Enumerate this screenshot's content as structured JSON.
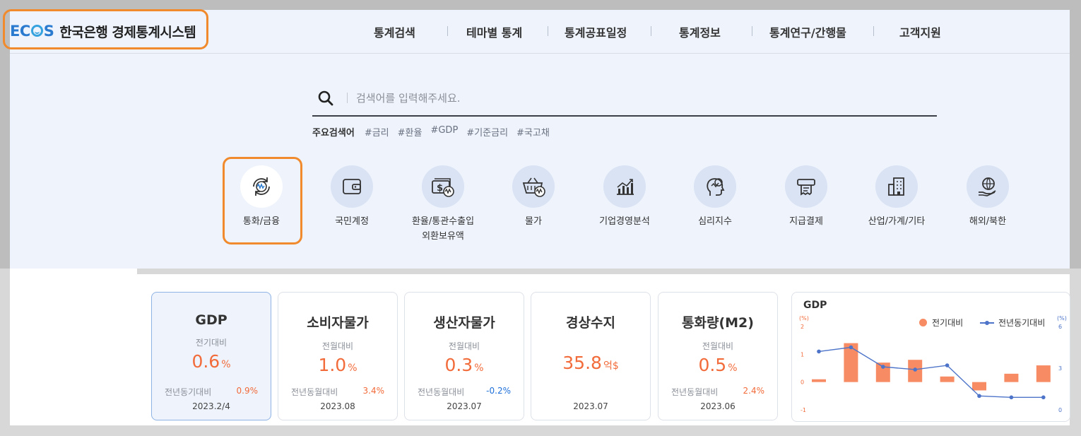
{
  "header": {
    "logo_brand": "ECOS",
    "logo_text": "한국은행 경제통계시스템",
    "nav": [
      "통계검색",
      "테마별 통계",
      "통계공표일정",
      "통계정보",
      "통계연구/간행물",
      "고객지원"
    ]
  },
  "search": {
    "placeholder": "검색어를 입력해주세요.",
    "keywords_label": "주요검색어",
    "keywords": [
      "#금리",
      "#환율",
      "#GDP",
      "#기준금리",
      "#국고채"
    ]
  },
  "categories": [
    {
      "label": "통화/금융",
      "icon": "currency-exchange-icon"
    },
    {
      "label": "국민계정",
      "icon": "wallet-icon"
    },
    {
      "label": "환율/통관수출입\n외환보유액",
      "icon": "money-exchange-icon"
    },
    {
      "label": "물가",
      "icon": "basket-icon"
    },
    {
      "label": "기업경영분석",
      "icon": "bar-chart-icon"
    },
    {
      "label": "심리지수",
      "icon": "head-icon"
    },
    {
      "label": "지급결제",
      "icon": "payment-icon"
    },
    {
      "label": "산업/가계/기타",
      "icon": "building-icon"
    },
    {
      "label": "해외/북한",
      "icon": "globe-hand-icon"
    }
  ],
  "cards": [
    {
      "title": "GDP",
      "sublabel": "전기대비",
      "value": "0.6",
      "unit": "%",
      "yoy_label": "전년동기대비",
      "yoy_value": "0.9%",
      "date": "2023.2/4"
    },
    {
      "title": "소비자물가",
      "sublabel": "전월대비",
      "value": "1.0",
      "unit": "%",
      "yoy_label": "전년동월대비",
      "yoy_value": "3.4%",
      "date": "2023.08"
    },
    {
      "title": "생산자물가",
      "sublabel": "전월대비",
      "value": "0.3",
      "unit": "%",
      "yoy_label": "전년동월대비",
      "yoy_value": "-0.2%",
      "date": "2023.07"
    },
    {
      "title": "경상수지",
      "sublabel": "",
      "value": "35.8",
      "unit": "억$",
      "yoy_label": "",
      "yoy_value": "",
      "date": "2023.07"
    },
    {
      "title": "통화량(M2)",
      "sublabel": "전월대비",
      "value": "0.5",
      "unit": "%",
      "yoy_label": "전년동월대비",
      "yoy_value": "2.4%",
      "date": "2023.06"
    }
  ],
  "colors": {
    "accent": "#f26b3a",
    "negative": "#1e6fd9",
    "brand": "#2a7bd0",
    "highlight": "#f08a2c"
  },
  "chart_data": {
    "type": "bar",
    "title": "GDP",
    "legend": [
      "전기대비",
      "전년동기대비"
    ],
    "left_axis": {
      "unit": "(%)",
      "ticks": [
        2,
        1,
        0,
        -1
      ],
      "ylim": [
        -1,
        2
      ]
    },
    "right_axis": {
      "unit": "(%)",
      "ticks": [
        6,
        3,
        0
      ],
      "ylim": [
        0,
        6
      ]
    },
    "series": [
      {
        "name": "전기대비",
        "kind": "bar",
        "axis": "left",
        "values": [
          0.1,
          1.4,
          0.7,
          0.8,
          0.2,
          -0.3,
          0.3,
          0.6
        ]
      },
      {
        "name": "전년동기대비",
        "kind": "line",
        "axis": "right",
        "values": [
          4.2,
          4.5,
          3.1,
          2.9,
          3.2,
          1.0,
          0.9,
          0.9
        ]
      }
    ]
  }
}
